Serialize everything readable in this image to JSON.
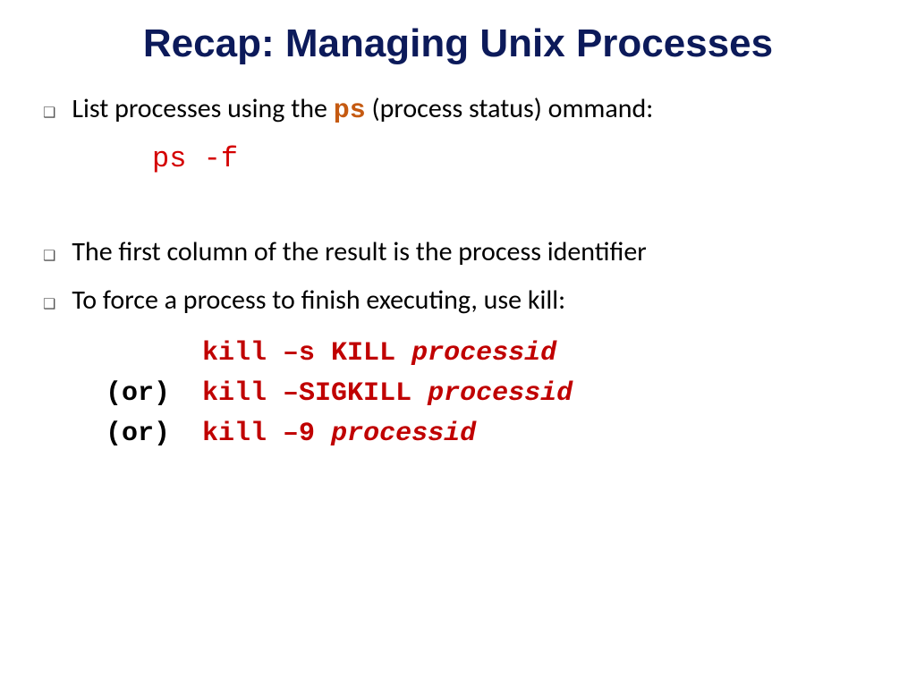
{
  "title": "Recap: Managing Unix Processes",
  "bullet1_pre": "List processes using the ",
  "bullet1_code": "ps",
  "bullet1_post": " (process status) ommand:",
  "code1": "ps -f",
  "bullet2": "The first column of the result is the process identifier",
  "bullet3": "To force a process to finish executing, use kill:",
  "kill": {
    "indent": "      ",
    "line1_cmd": "kill –s KILL ",
    "line1_arg": "processid",
    "or_label": "(or)",
    "gap": "  ",
    "line2_cmd": "kill –SIGKILL ",
    "line2_arg": "processid",
    "line3_cmd": "kill –9 ",
    "line3_arg": "processid"
  }
}
